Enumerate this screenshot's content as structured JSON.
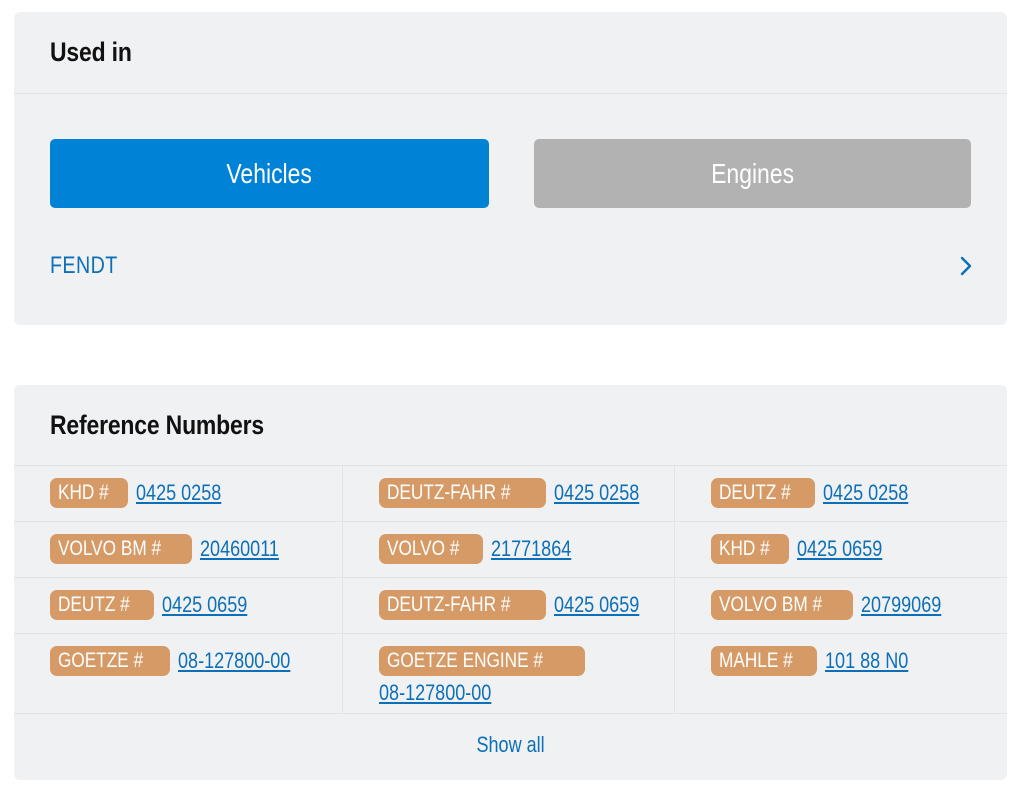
{
  "used_in": {
    "title": "Used in",
    "tabs": [
      {
        "label": "Vehicles",
        "active": true
      },
      {
        "label": "Engines",
        "active": false
      }
    ],
    "items": [
      {
        "label": "FENDT"
      }
    ]
  },
  "reference_numbers": {
    "title": "Reference Numbers",
    "rows": [
      [
        {
          "brand": "KHD #",
          "number": "0425 0258"
        },
        {
          "brand": "DEUTZ-FAHR #",
          "number": "0425 0258"
        },
        {
          "brand": "DEUTZ #",
          "number": "0425 0258"
        }
      ],
      [
        {
          "brand": "VOLVO BM #",
          "number": "20460011"
        },
        {
          "brand": "VOLVO #",
          "number": "21771864"
        },
        {
          "brand": "KHD #",
          "number": "0425 0659"
        }
      ],
      [
        {
          "brand": "DEUTZ #",
          "number": "0425 0659"
        },
        {
          "brand": "DEUTZ-FAHR #",
          "number": "0425 0659"
        },
        {
          "brand": "VOLVO BM #",
          "number": "20799069"
        }
      ],
      [
        {
          "brand": "GOETZE #",
          "number": "08-127800-00"
        },
        {
          "brand": "GOETZE ENGINE #",
          "number": "08-127800-00"
        },
        {
          "brand": "MAHLE #",
          "number": "101 88 N0"
        }
      ]
    ],
    "show_all_label": "Show all"
  },
  "colors": {
    "primary": "#0083d6",
    "inactive": "#b2b2b2",
    "badge": "#d69a66",
    "link": "#0c6fb7",
    "card_bg": "#f0f1f3"
  }
}
